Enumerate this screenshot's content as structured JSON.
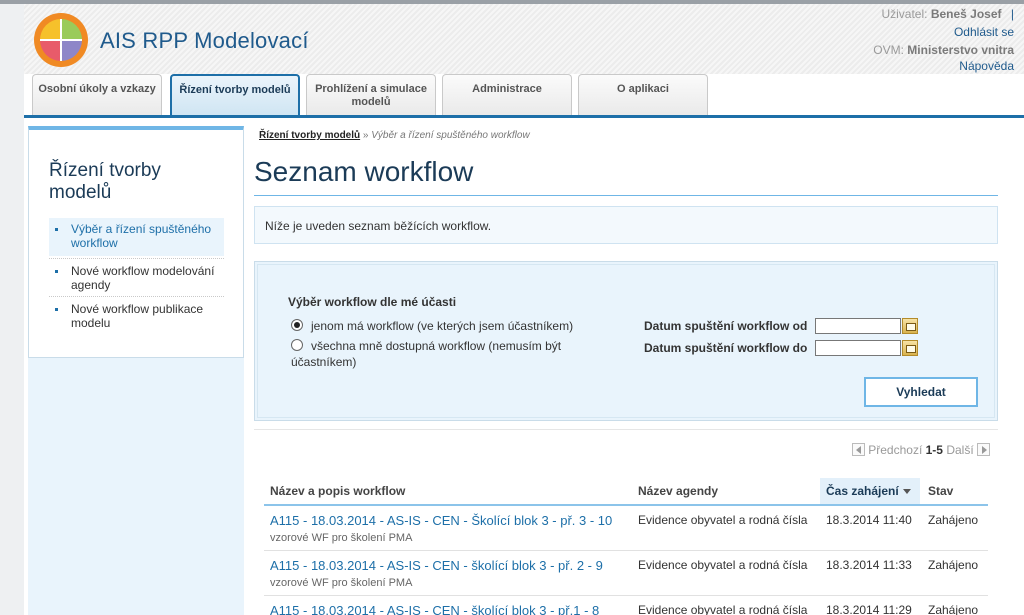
{
  "app": {
    "title": "AIS RPP Modelovací"
  },
  "user": {
    "user_label": "Uživatel:",
    "user_name": "Beneš Josef",
    "separator": "|",
    "logout": "Odhlásit se",
    "ovm_label": "OVM:",
    "ovm_name": "Ministerstvo vnitra",
    "help": "Nápověda"
  },
  "tabs": [
    {
      "label": "Osobní úkoly a vzkazy"
    },
    {
      "label": "Řízení tvorby modelů",
      "active": true
    },
    {
      "label": "Prohlížení a simulace modelů"
    },
    {
      "label": "Administrace"
    },
    {
      "label": "O aplikaci"
    }
  ],
  "sidebar": {
    "title": "Řízení tvorby modelů",
    "items": [
      {
        "label": "Výběr a řízení spuštěného workflow",
        "active": true
      },
      {
        "label": "Nové workflow modelování agendy"
      },
      {
        "label": "Nové workflow publikace modelu"
      }
    ]
  },
  "breadcrumb": {
    "parent": "Řízení tvorby modelů",
    "separator": "»",
    "current": "Výběr a řízení spuštěného workflow"
  },
  "main": {
    "title": "Seznam workflow",
    "info": "Níže je uveden seznam běžících workflow."
  },
  "filter": {
    "heading": "Výběr workflow dle mé účasti",
    "option1": "jenom má workflow (ve kterých jsem účastníkem)",
    "option2_line1": "všechna mně dostupná workflow (nemusím být",
    "option2_line2": "účastníkem)",
    "selected_option": 1,
    "date_from_label": "Datum spuštění workflow od",
    "date_to_label": "Datum spuštění workflow do",
    "date_from_value": "",
    "date_to_value": "",
    "search_button": "Vyhledat"
  },
  "pager": {
    "prev": "Předchozí",
    "range": "1-5",
    "next": "Další"
  },
  "table": {
    "columns": [
      {
        "label": "Název a popis workflow"
      },
      {
        "label": "Název agendy"
      },
      {
        "label": "Čas zahájení",
        "sorted": "desc"
      },
      {
        "label": "Stav"
      }
    ],
    "rows": [
      {
        "name": "A115 - 18.03.2014 - AS-IS - CEN - Školící blok 3 - př. 3 - 10",
        "desc": "vzorové WF pro školení PMA",
        "agenda": "Evidence obyvatel a rodná čísla",
        "time": "18.3.2014 11:40",
        "status": "Zahájeno"
      },
      {
        "name": "A115 - 18.03.2014 - AS-IS - CEN - školící blok 3 - př. 2 - 9",
        "desc": "vzorové WF pro školení PMA",
        "agenda": "Evidence obyvatel a rodná čísla",
        "time": "18.3.2014 11:33",
        "status": "Zahájeno"
      },
      {
        "name": "A115 - 18.03.2014 - AS-IS - CEN - školící blok 3 - př.1 - 8",
        "desc": "",
        "agenda": "Evidence obyvatel a rodná čísla",
        "time": "18.3.2014 11:29",
        "status": "Zahájeno"
      }
    ]
  },
  "colors": {
    "brand": "#1f5a8c",
    "accent": "#1d6fa8",
    "light_accent": "#6fb6e6",
    "panel": "#e9f4fc"
  },
  "icons": {
    "logo": "quartered-circle-logo",
    "calendar": "calendar-icon",
    "sort": "sort-desc-icon"
  }
}
